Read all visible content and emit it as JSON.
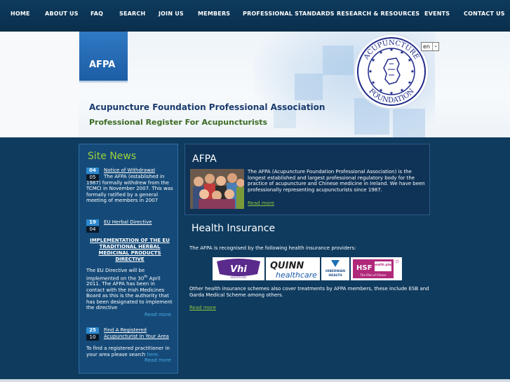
{
  "nav": {
    "items": [
      "HOME",
      "ABOUT US",
      "FAQ",
      "SEARCH",
      "JOIN US",
      "MEMBERS",
      "PROFESSIONAL STANDARDS",
      "RESEARCH & RESOURCES",
      "EVENTS",
      "CONTACT US"
    ]
  },
  "header": {
    "tab_label": "AFPA",
    "title": "Acupuncture Foundation Professional Association",
    "subtitle": "Professional Register For Acupuncturists",
    "language": "en",
    "seal_top": "ACUPUNCTURE",
    "seal_bottom": "FOUNDATION"
  },
  "news": {
    "title": "Site News",
    "items": [
      {
        "day": "04",
        "month": "05",
        "link": "Notice of Withdrawal",
        "text": "The AFPA (established in 1987) formally withdrew from the TCMCI in November 2007. This was formally ratified by a general meeting of members in 2007"
      },
      {
        "day": "19",
        "month": "04",
        "link": "EU Herbal Directive",
        "heading": "IMPLEMENTATION OF THE EU TRADITIONAL HERBAL MEDICINAL PRODUCTS DIRECTIVE",
        "text_before_sup": "The EU Directive will be implemented on the 30",
        "sup": "th",
        "text_after_sup": " April 2011. The AFPA has been in contact with the Irish Medicines Board as this is the authority that has been designated to implement the directive",
        "readmore": "Read more"
      },
      {
        "day": "25",
        "month": "10",
        "link_line1": "Find A Registered",
        "link_line2": "Acupuncturist In Your Area",
        "text": "To find a registered practitioner in your area please search ",
        "here": "here.",
        "readmore": "Read more"
      }
    ]
  },
  "afpa": {
    "title": "AFPA",
    "description": "The AFPA (Acupuncture Foundation Professional Association) is  the longest established and largest professional regulatory body for the practice of acupuncture and Chinese medicine in Ireland. We have been professionally representing acupuncturists since 1987.",
    "readmore": "Read more"
  },
  "health": {
    "title": "Health Insurance",
    "intro": "The AFPA is recognised by the following health insurance providers:",
    "logos": {
      "vhi": "Vhi",
      "vhi_sub": "HEALTHCARE",
      "quinn": "QUINN",
      "quinn_sub": "healthcare",
      "hibernian1": "HIBERNIAN",
      "hibernian2": "HEALTH",
      "hsf": "HSF",
      "hsf_side": "health plan",
      "hsf_sub": "The Plan of Choice"
    },
    "other": "Other health insurance schemes also cover treatments by AFPA members, these include ESB and Garda Medical Scheme among others.",
    "readmore": "Read more"
  },
  "colors": {
    "nav_bg": "#0e3a5c",
    "page_bg": "#0f3b5f",
    "accent_green": "#9ed23a",
    "accent_blue": "#2e8ad0",
    "title_blue": "#1a3b6e",
    "subtitle_green": "#3b6b23"
  }
}
